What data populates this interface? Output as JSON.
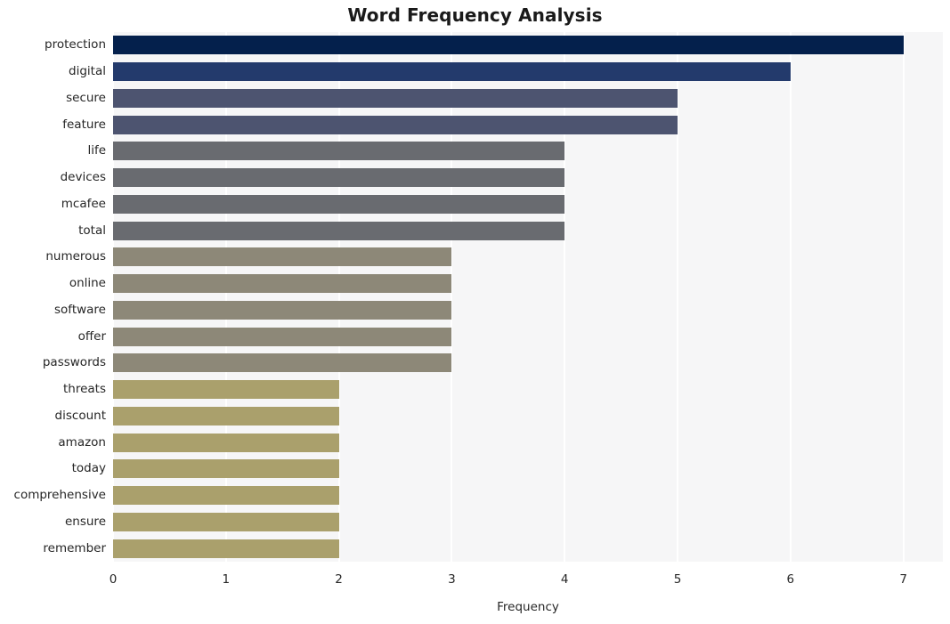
{
  "chart_data": {
    "type": "bar",
    "orientation": "horizontal",
    "title": "Word Frequency Analysis",
    "xlabel": "Frequency",
    "ylabel": "",
    "xlim": [
      0,
      7.35
    ],
    "xticks": [
      "0",
      "1",
      "2",
      "3",
      "4",
      "5",
      "6",
      "7"
    ],
    "xtick_values": [
      0,
      1,
      2,
      3,
      4,
      5,
      6,
      7
    ],
    "grid": true,
    "grid_axis": "x",
    "legend": "none",
    "categories": [
      "protection",
      "digital",
      "secure",
      "feature",
      "life",
      "devices",
      "mcafee",
      "total",
      "numerous",
      "online",
      "software",
      "offer",
      "passwords",
      "threats",
      "discount",
      "amazon",
      "today",
      "comprehensive",
      "ensure",
      "remember"
    ],
    "values": [
      7,
      6,
      5,
      5,
      4,
      4,
      4,
      4,
      3,
      3,
      3,
      3,
      3,
      2,
      2,
      2,
      2,
      2,
      2,
      2
    ],
    "bar_colors": [
      "#04204c",
      "#233a6c",
      "#4d5470",
      "#4d5470",
      "#696b70",
      "#696b70",
      "#696b70",
      "#696b70",
      "#8d8878",
      "#8d8878",
      "#8d8878",
      "#8d8878",
      "#8d8878",
      "#aaa06c",
      "#aaa06c",
      "#aaa06c",
      "#aaa06c",
      "#aaa06c",
      "#aaa06c",
      "#aaa06c"
    ]
  },
  "style": {
    "plot_background": "#f6f6f7",
    "figure_background": "#ffffff",
    "gridline_color": "#ffffff",
    "text_color": "#262626",
    "title_color": "#1a1a1a"
  }
}
